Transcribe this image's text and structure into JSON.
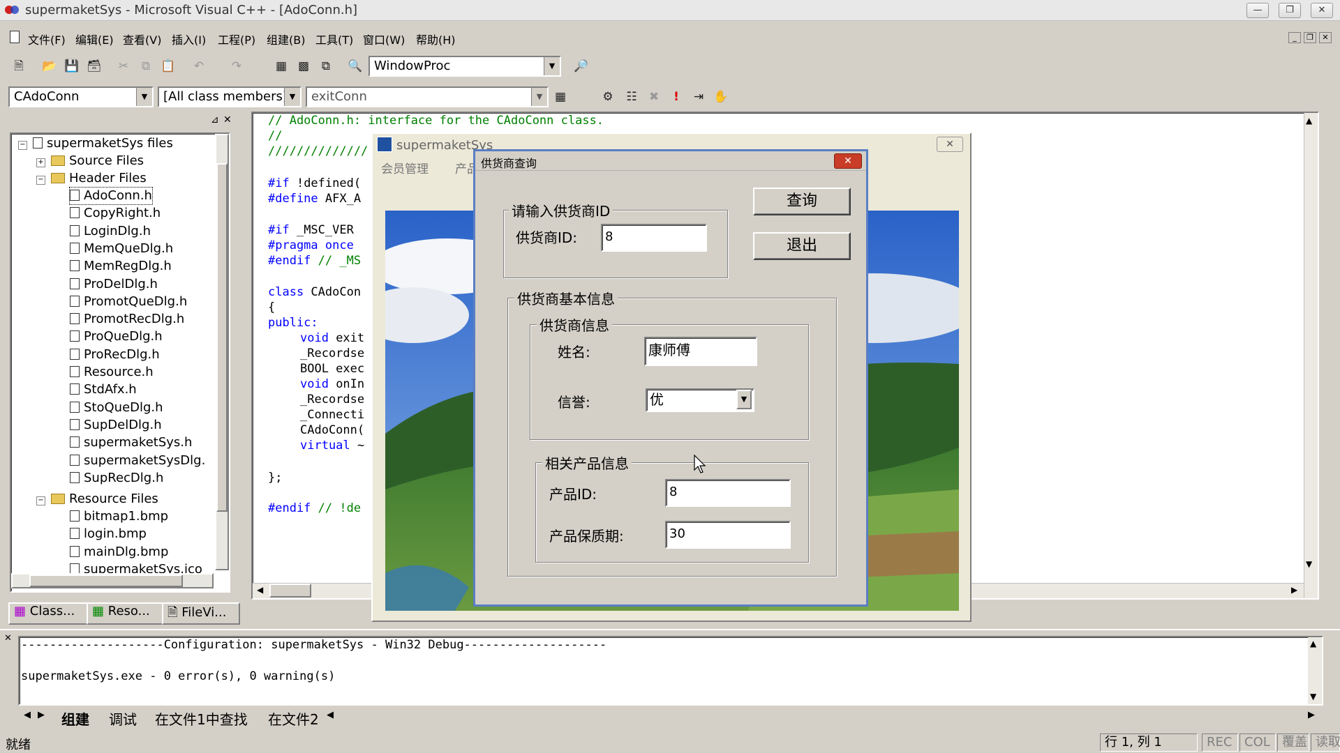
{
  "window": {
    "title": "supermaketSys - Microsoft Visual C++ - [AdoConn.h]"
  },
  "menu": [
    "文件(F)",
    "编辑(E)",
    "查看(V)",
    "插入(I)",
    "工程(P)",
    "组建(B)",
    "工具(T)",
    "窗口(W)",
    "帮助(H)"
  ],
  "toolbar": {
    "function_combo": "WindowProc",
    "class_combo": "CAdoConn",
    "filter_combo": "[All class members]",
    "member_combo": "exitConn"
  },
  "workspace": {
    "root": "supermaketSys files",
    "source_folder": "Source Files",
    "header_folder": "Header Files",
    "header_files": [
      "AdoConn.h",
      "CopyRight.h",
      "LoginDlg.h",
      "MemQueDlg.h",
      "MemRegDlg.h",
      "ProDelDlg.h",
      "PromotQueDlg.h",
      "PromotRecDlg.h",
      "ProQueDlg.h",
      "ProRecDlg.h",
      "Resource.h",
      "StdAfx.h",
      "StoQueDlg.h",
      "SupDelDlg.h",
      "supermaketSys.h",
      "supermaketSysDlg.",
      "SupRecDlg.h"
    ],
    "resource_folder": "Resource Files",
    "resource_files": [
      "bitmap1.bmp",
      "login.bmp",
      "mainDlg.bmp",
      "supermaketSys.ico"
    ],
    "tabs": [
      "Class...",
      "Reso...",
      "FileVi..."
    ]
  },
  "code": {
    "line1": "// AdoConn.h: interface for the CAdoConn class.",
    "line2": "//",
    "line3": "//////////////",
    "line4a": "#if",
    "line4b": " !defined(",
    "line5a": "#define",
    "line5b": " AFX_A",
    "line6a": "#if",
    "line6b": " _MSC_VER",
    "line7a": "#pragma once",
    "line8a": "#endif",
    "line8b": " // _MS",
    "line9a": "class",
    "line9b": " CAdoCon",
    "line10": "{",
    "line11": "public:",
    "line12a": "void",
    "line12b": " exit",
    "line13": "_Recordse",
    "line14": "BOOL exec",
    "line15a": "void",
    "line15b": " onIn",
    "line16": "_Recordse",
    "line17": "_Connecti",
    "line18": "CAdoConn(",
    "line19a": "virtual",
    "line19b": " ~",
    "line20": "};",
    "line21a": "#endif",
    "line21b": " // !de"
  },
  "output": {
    "config_line": "--------------------Configuration: supermaketSys - Win32 Debug--------------------",
    "result_line": "supermaketSys.exe - 0 error(s), 0 warning(s)",
    "tabs": [
      "组建",
      "调试",
      "在文件1中查找",
      "在文件2"
    ]
  },
  "status": {
    "ready": "就绪",
    "position": "行 1, 列 1",
    "rec": "REC",
    "col": "COL",
    "ovr": "覆盖",
    "read": "读取"
  },
  "main_dialog": {
    "title": "supermaketSys",
    "menu1": "会员管理",
    "menu2": "产品"
  },
  "supplier_dialog": {
    "title": "供货商查询",
    "group_input": "请输入供货商ID",
    "id_label": "供货商ID:",
    "id_value": "8",
    "query_button": "查询",
    "exit_button": "退出",
    "group_basic": "供货商基本信息",
    "group_supplier": "供货商信息",
    "name_label": "姓名:",
    "name_value": "康师傅",
    "credit_label": "信誉:",
    "credit_value": "优",
    "group_product": "相关产品信息",
    "product_id_label": "产品ID:",
    "product_id_value": "8",
    "shelf_label": "产品保质期:",
    "shelf_value": "30"
  }
}
